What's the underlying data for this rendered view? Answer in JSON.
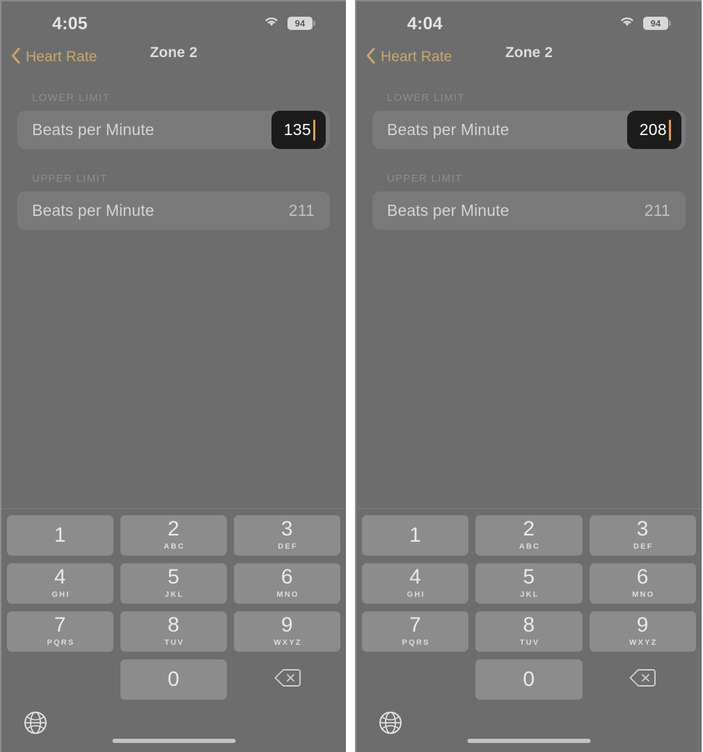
{
  "panels": [
    {
      "id": "panel-left",
      "status": {
        "time": "4:05",
        "wifi_icon": "wifi-icon",
        "battery_level": "94"
      },
      "nav": {
        "back_icon": "chevron-left-icon",
        "back_label": "Heart Rate",
        "title": "Zone 2"
      },
      "sections": [
        {
          "header": "LOWER LIMIT",
          "placeholder": "Beats per Minute",
          "value": "135",
          "selected": true
        },
        {
          "header": "UPPER LIMIT",
          "placeholder": "Beats per Minute",
          "value": "211",
          "selected": false
        }
      ]
    },
    {
      "id": "panel-right",
      "status": {
        "time": "4:04",
        "wifi_icon": "wifi-icon",
        "battery_level": "94"
      },
      "nav": {
        "back_icon": "chevron-left-icon",
        "back_label": "Heart Rate",
        "title": "Zone 2"
      },
      "sections": [
        {
          "header": "LOWER LIMIT",
          "placeholder": "Beats per Minute",
          "value": "208",
          "selected": true
        },
        {
          "header": "UPPER LIMIT",
          "placeholder": "Beats per Minute",
          "value": "211",
          "selected": false
        }
      ]
    }
  ],
  "keypad": {
    "keys": [
      {
        "digit": "1",
        "letters": ""
      },
      {
        "digit": "2",
        "letters": "ABC"
      },
      {
        "digit": "3",
        "letters": "DEF"
      },
      {
        "digit": "4",
        "letters": "GHI"
      },
      {
        "digit": "5",
        "letters": "JKL"
      },
      {
        "digit": "6",
        "letters": "MNO"
      },
      {
        "digit": "7",
        "letters": "PQRS"
      },
      {
        "digit": "8",
        "letters": "TUV"
      },
      {
        "digit": "9",
        "letters": "WXYZ"
      },
      {
        "digit": "",
        "letters": "",
        "blank": true
      },
      {
        "digit": "0",
        "letters": ""
      },
      {
        "digit": "",
        "letters": "",
        "action": "delete-icon"
      }
    ],
    "globe_icon": "globe-icon",
    "delete_icon": "delete-backspace-icon"
  },
  "colors": {
    "panel_background": "#6d6d6d",
    "field_background": "#7a7a7a",
    "accent_back_link": "#c9a86a",
    "caret": "#e8a030",
    "chip_background": "#1c1c1c",
    "key_background": "#8c8c8c"
  }
}
